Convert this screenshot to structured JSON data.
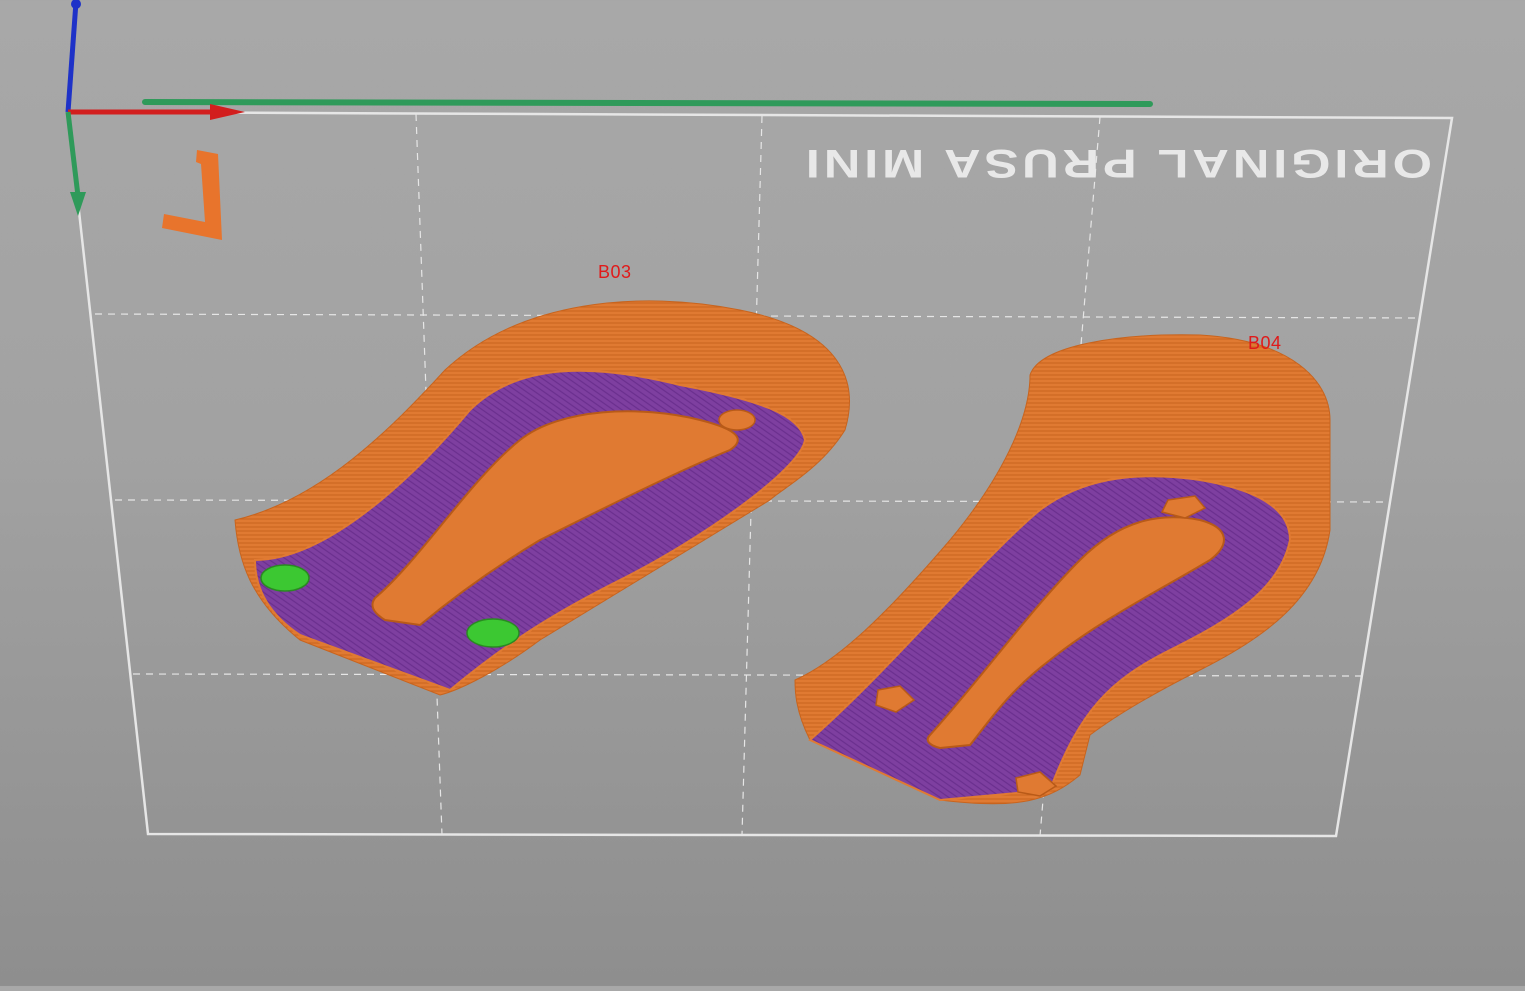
{
  "scene": {
    "bed_logo_text": "ORIGINAL PRUSA MINI",
    "colors": {
      "background": "#a4a4a4",
      "bed_outline": "#e6e6e6",
      "grid": "#e0e0e0",
      "part_wall": "#e07a32",
      "part_top": "#7e3fa0",
      "support_enforcer": "#3cc832",
      "axis_x": "#d21e1e",
      "axis_y": "#2f9a5a",
      "axis_z": "#1e32c8",
      "origin_marker": "#e8742c"
    },
    "objects": [
      {
        "id": "B03",
        "label": "B03"
      },
      {
        "id": "B04",
        "label": "B04"
      }
    ]
  }
}
